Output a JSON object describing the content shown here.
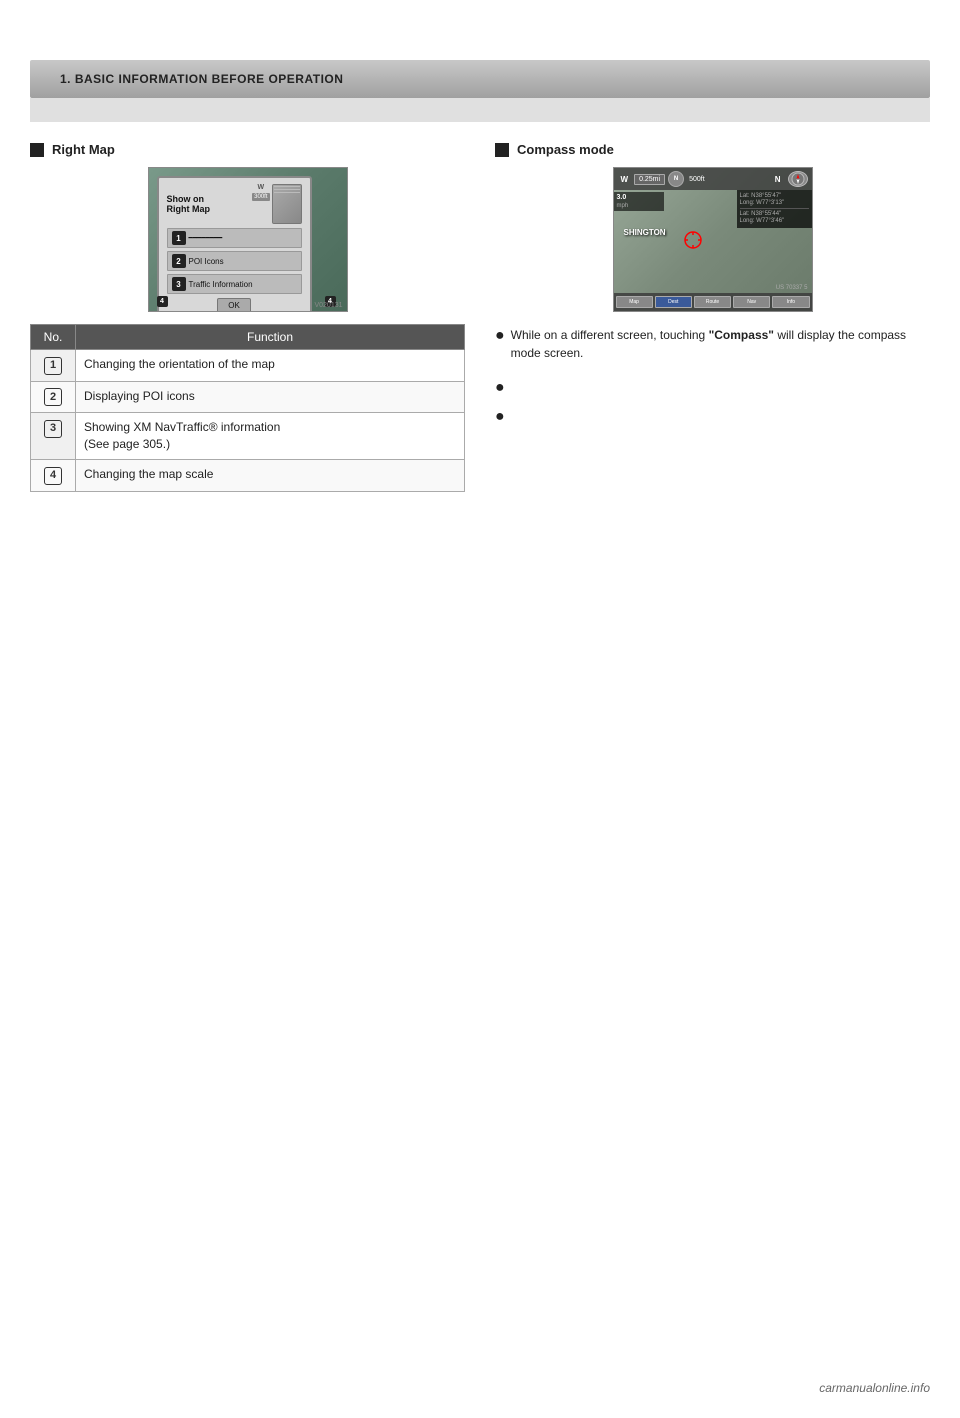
{
  "header": {
    "section": "1. BASIC INFORMATION BEFORE OPERATION"
  },
  "left_section": {
    "title": "Right Map",
    "image_label": "Show on Right Map dialog",
    "dialog": {
      "title_line1": "Show on",
      "title_line2": "Right Map",
      "row1_badge": "1",
      "row2_badge": "2",
      "row2_label": "POI Icons",
      "row3_badge": "3",
      "row3_label": "Traffic Information",
      "ok_label": "OK",
      "bottom_badge1": "4",
      "bottom_badge2": "4",
      "version_code": "V020131"
    },
    "table": {
      "col1_header": "No.",
      "col2_header": "Function",
      "rows": [
        {
          "no": "1",
          "function": "Changing the orientation of the map"
        },
        {
          "no": "2",
          "function": "Displaying POI icons"
        },
        {
          "no": "3",
          "function": "Showing XM NavTraffic® information\n(See page 305.)"
        },
        {
          "no": "4",
          "function": "Changing the map scale"
        }
      ]
    }
  },
  "right_section": {
    "title": "Compass mode",
    "map_labels": {
      "distance": "0.25mi",
      "scale": "500ft",
      "city": "SHINGTON",
      "lat1_label": "Lat: N38°55'47\"",
      "lon1_label": "Long: W77°3'13\"",
      "lat2_label": "Lat: N38°55'44\"",
      "lon2_label": "Long: W77°3'46\"",
      "img_code": "US 70337 5"
    },
    "bullets": [
      {
        "text_before": "While on a different screen, touching ",
        "bold_word": "\"Compass\"",
        "text_after": " will display the compass mode screen."
      }
    ],
    "extra_bullets": [
      "",
      ""
    ]
  },
  "footer": {
    "logo_text": "carmanualonline.info"
  }
}
